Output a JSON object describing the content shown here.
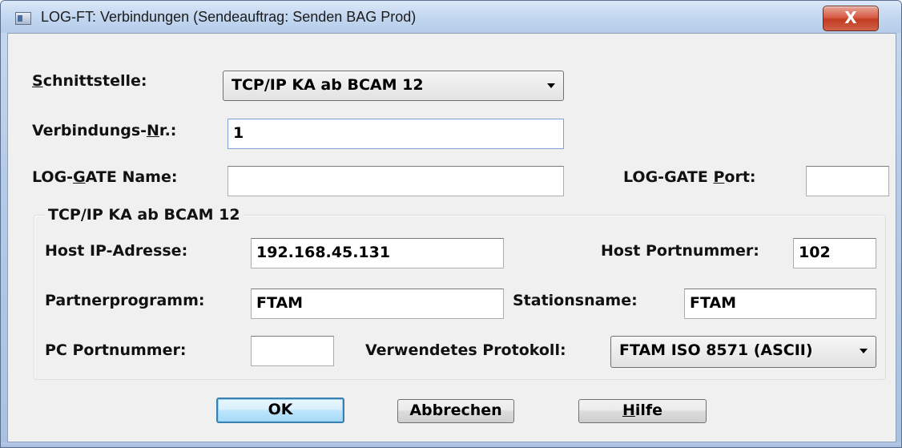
{
  "window": {
    "title": "LOG-FT: Verbindungen (Sendeauftrag: Senden BAG Prod)",
    "close_glyph": "X"
  },
  "fields": {
    "schnittstelle": {
      "label_pre": "",
      "label_key": "S",
      "label_post": "chnittstelle:",
      "value": "TCP/IP KA ab BCAM 12"
    },
    "verbindungs_nr": {
      "label_pre": "Verbindungs-",
      "label_key": "N",
      "label_post": "r.:",
      "value": "1"
    },
    "log_gate_name": {
      "label_pre": "LOG-",
      "label_key": "G",
      "label_post": "ATE Name:",
      "value": ""
    },
    "log_gate_port": {
      "label_pre": "LOG-GATE ",
      "label_key": "P",
      "label_post": "ort:",
      "value": ""
    }
  },
  "group": {
    "legend": "TCP/IP KA ab BCAM 12",
    "host_ip": {
      "label": "Host IP-Adresse:",
      "value": "192.168.45.131"
    },
    "host_port": {
      "label": "Host Portnummer:",
      "value": "102"
    },
    "partnerprogramm": {
      "label": "Partnerprogramm:",
      "value": "FTAM"
    },
    "stationsname": {
      "label": "Stationsname:",
      "value": "FTAM"
    },
    "pc_port": {
      "label": "PC Portnummer:",
      "value": ""
    },
    "protokoll": {
      "label": "Verwendetes Protokoll:",
      "value": "FTAM ISO 8571 (ASCII)"
    }
  },
  "buttons": {
    "ok": "OK",
    "abbrechen": "Abbrechen",
    "hilfe_key": "H",
    "hilfe_rest": "ilfe"
  },
  "icons": {
    "app": "window-app-icon",
    "close": "close-icon",
    "dropdown": "chevron-down-icon"
  }
}
